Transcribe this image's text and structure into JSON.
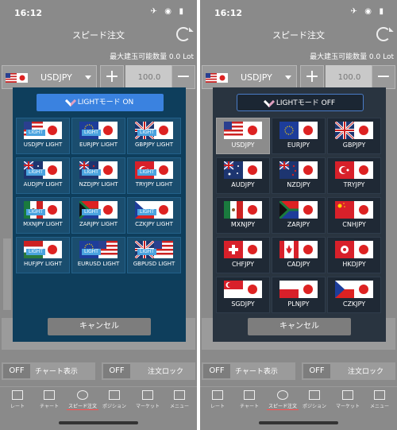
{
  "status": {
    "time": "16:12"
  },
  "nav": {
    "title": "スピード注文"
  },
  "max_lot": "最大建玉可能数量 0.0 Lot",
  "pair_select": {
    "label": "USDJPY"
  },
  "quantity": {
    "value": "100.0"
  },
  "toggles": {
    "off": "OFF",
    "chart": "チャート表示",
    "lock": "注文ロック"
  },
  "tabs": [
    "レート",
    "チャート",
    "スピード注文",
    "ポジション",
    "マーケット",
    "メニュー"
  ],
  "modal_on": {
    "mode_label": "LIGHTモード ON",
    "badge": "LIGHT",
    "items": [
      "USDJPY LIGHT",
      "EURJPY LIGHT",
      "GBPJPY LIGHT",
      "AUDJPY LIGHT",
      "NZDJPY LIGHT",
      "TRYJPY LIGHT",
      "MXNJPY LIGHT",
      "ZARJPY LIGHT",
      "CZKJPY LIGHT",
      "HUFJPY LIGHT",
      "EURUSD LIGHT",
      "GBPUSD LIGHT"
    ]
  },
  "modal_off": {
    "mode_label": "LIGHTモード OFF",
    "items": [
      "USDJPY",
      "EURJPY",
      "GBPJPY",
      "AUDJPY",
      "NZDJPY",
      "TRYJPY",
      "MXNJPY",
      "ZARJPY",
      "CNHJPY",
      "CHFJPY",
      "CADJPY",
      "HKDJPY",
      "SGDJPY",
      "PLNJPY",
      "CZKJPY"
    ]
  },
  "cancel_label": "キャンセル",
  "colors": {
    "light_on_bg": "#0e3e5c",
    "light_off_bg": "#293440",
    "accent": "#3a82e0"
  }
}
